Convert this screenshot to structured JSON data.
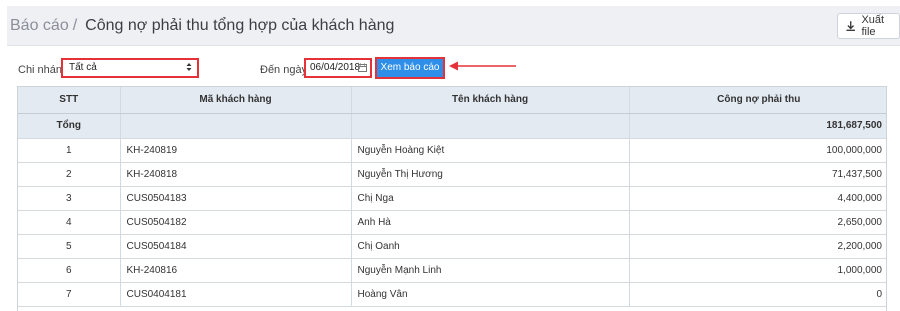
{
  "header": {
    "breadcrumb_root": "Báo cáo",
    "breadcrumb_sep": "/",
    "page_title": "Công nợ phải thu tổng hợp của khách hàng",
    "export_label": "Xuất file"
  },
  "filters": {
    "branch_label": "Chi nhánh",
    "branch_value": "Tất cả",
    "date_label": "Đến ngày",
    "date_value": "06/04/2018",
    "report_button": "Xem báo cáo"
  },
  "table": {
    "columns": [
      "STT",
      "Mã khách hàng",
      "Tên khách hàng",
      "Công nợ phải thu"
    ],
    "total_label": "Tổng",
    "total_amount": "181,687,500",
    "rows": [
      {
        "stt": "1",
        "code": "KH-240819",
        "name": "Nguyễn Hoàng Kiệt",
        "amount": "100,000,000"
      },
      {
        "stt": "2",
        "code": "KH-240818",
        "name": "Nguyễn Thị Hương",
        "amount": "71,437,500"
      },
      {
        "stt": "3",
        "code": "CUS0504183",
        "name": "Chị Nga",
        "amount": "4,400,000"
      },
      {
        "stt": "4",
        "code": "CUS0504182",
        "name": "Anh Hà",
        "amount": "2,650,000"
      },
      {
        "stt": "5",
        "code": "CUS0504184",
        "name": "Chị Oanh",
        "amount": "2,200,000"
      },
      {
        "stt": "6",
        "code": "KH-240816",
        "name": "Nguyễn Mạnh Linh",
        "amount": "1,000,000"
      },
      {
        "stt": "7",
        "code": "CUS0404181",
        "name": "Hoàng Vân",
        "amount": "0"
      }
    ]
  },
  "colors": {
    "accent": "#2e8ee8",
    "highlight": "#e53238",
    "header_bg": "#eef0f4",
    "table_header_bg": "#e3eaf2"
  },
  "icons": {
    "export": "download-icon",
    "select": "select-arrows-icon",
    "date": "calendar-icon",
    "pointer": "arrow-left-icon"
  }
}
